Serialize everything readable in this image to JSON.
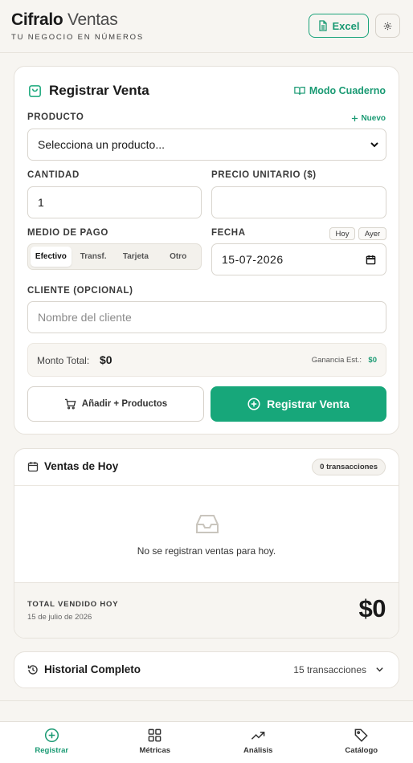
{
  "header": {
    "brand_bold": "Cifralo",
    "brand_light": "Ventas",
    "tagline": "TU NEGOCIO EN NÚMEROS",
    "excel_label": "Excel"
  },
  "register": {
    "title": "Registrar Venta",
    "notebook_mode": "Modo Cuaderno",
    "product_label": "PRODUCTO",
    "new_label": "Nuevo",
    "product_selected": "Selecciona un producto...",
    "quantity_label": "CANTIDAD",
    "quantity_value": "1",
    "unit_price_label": "PRECIO UNITARIO ($)",
    "unit_price_value": "",
    "payment_label": "MEDIO DE PAGO",
    "payment_options": [
      "Efectivo",
      "Transf.",
      "Tarjeta",
      "Otro"
    ],
    "payment_selected": "Efectivo",
    "date_label": "FECHA",
    "today_btn": "Hoy",
    "yesterday_btn": "Ayer",
    "date_value": "15-07-2026",
    "client_label": "CLIENTE (OPCIONAL)",
    "client_placeholder": "Nombre del cliente",
    "total_label": "Monto Total:",
    "total_value": "$0",
    "profit_label": "Ganancia Est.:",
    "profit_value": "$0",
    "add_products_btn": "Añadir + Productos",
    "register_btn": "Registrar Venta"
  },
  "today": {
    "title": "Ventas de Hoy",
    "badge": "0 transacciones",
    "empty_message": "No se registran ventas para hoy.",
    "total_label": "TOTAL VENDIDO HOY",
    "date": "15 de julio de 2026",
    "total_value": "$0"
  },
  "history": {
    "title": "Historial Completo",
    "count": "15 transacciones"
  },
  "nav": {
    "items": [
      {
        "label": "Registrar",
        "icon": "plus-circle-icon"
      },
      {
        "label": "Métricas",
        "icon": "grid-icon"
      },
      {
        "label": "Análisis",
        "icon": "trending-up-icon"
      },
      {
        "label": "Catálogo",
        "icon": "tag-icon"
      }
    ],
    "active": "Registrar"
  },
  "colors": {
    "accent": "#17a77a",
    "background": "#f7f5f1"
  }
}
